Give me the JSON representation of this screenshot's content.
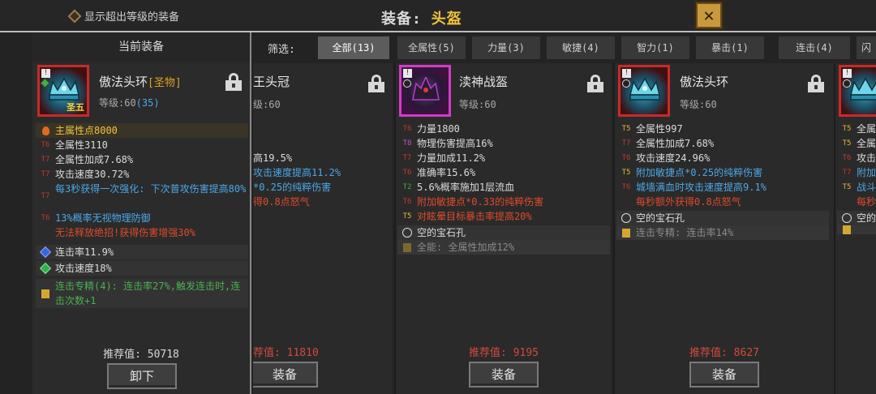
{
  "top": {
    "show_over_level": "显示超出等级的装备",
    "title_label": "装备:",
    "title_value": "头盔",
    "close_symbol": "✕"
  },
  "current": {
    "header": "当前装备",
    "name": "傲法头环",
    "quality": "[圣物]",
    "level_label": "等级:60",
    "level_bonus": "(35)",
    "icon_tag": "圣五",
    "badge": "!",
    "main_attr": "主属性点8000",
    "stats": [
      {
        "tier": "T6",
        "text": "全属性3110",
        "color": "white"
      },
      {
        "tier": "T7",
        "text": "全属性加成7.68%",
        "color": "white"
      },
      {
        "tier": "T7",
        "text": "攻击速度30.72%",
        "color": "white"
      },
      {
        "tier": "T7",
        "text": "每3秒获得一次强化: 下次普攻伤害提高80%",
        "color": "blue"
      },
      {
        "tier": "T6",
        "text": "13%概率无视物理防御",
        "color": "blue"
      }
    ],
    "legend_line": "无法释放绝招!获得伤害增强30%",
    "gem1": "连击率11.9%",
    "gem2": "攻击速度18%",
    "mastery": "连击专精(4): 连击率27%,触发连击时,连击次数+1",
    "rec_label": "推荐值:",
    "rec_value": "50718",
    "unequip": "卸下"
  },
  "filter": {
    "label": "筛选:",
    "tabs": [
      "全部(13)",
      "全属性(5)",
      "力量(3)",
      "敏捷(4)",
      "智力(1)",
      "暴击(1)",
      "连击(4)",
      "闪"
    ]
  },
  "items": [
    {
      "name": "王头冠",
      "level": "级:60",
      "stats": [
        {
          "tier": "",
          "text": "高19.5%",
          "color": "white"
        },
        {
          "tier": "",
          "text": "攻击速度提高11.2%",
          "color": "blue"
        },
        {
          "tier": "",
          "text": "*0.25的纯粹伤害",
          "color": "blue"
        },
        {
          "tier": "",
          "text": "得0.8点怒气",
          "color": "red"
        }
      ],
      "rec_label": "荐值:",
      "rec_value": "11810",
      "equip": "装备"
    },
    {
      "name": "渎神战盔",
      "level": "等级:60",
      "badge": "!",
      "stats": [
        {
          "tier": "T6",
          "text": "力量1800",
          "color": "white"
        },
        {
          "tier": "T8",
          "text": "物理伤害提高16%",
          "color": "white"
        },
        {
          "tier": "T7",
          "text": "力量加成11.2%",
          "color": "white"
        },
        {
          "tier": "T6",
          "text": "准确率15.6%",
          "color": "white"
        },
        {
          "tier": "T2",
          "text": "5.6%概率施加1层流血",
          "color": "white"
        },
        {
          "tier": "T6",
          "text": "附加敏捷点*0.33的纯粹伤害",
          "color": "red"
        },
        {
          "tier": "T5",
          "text": "对眩晕目标暴击率提高20%",
          "color": "red"
        }
      ],
      "socket": "空的宝石孔",
      "passive": "全能: 全属性加成12%",
      "rec_label": "推荐值:",
      "rec_value": "9195",
      "equip": "装备"
    },
    {
      "name": "傲法头环",
      "level": "等级:60",
      "badge": "!",
      "stats": [
        {
          "tier": "T5",
          "text": "全属性997",
          "color": "white"
        },
        {
          "tier": "T7",
          "text": "全属性加成7.68%",
          "color": "white"
        },
        {
          "tier": "T6",
          "text": "攻击速度24.96%",
          "color": "white"
        },
        {
          "tier": "T5",
          "text": "附加敏捷点*0.25的纯粹伤害",
          "color": "blue"
        },
        {
          "tier": "T6",
          "text": "城墙满血时攻击速度提高9.1%",
          "color": "blue"
        },
        {
          "tier": "",
          "text": "每秒额外获得0.8点怒气",
          "color": "red"
        }
      ],
      "socket": "空的宝石孔",
      "passive": "连击专精: 连击率14%",
      "rec_label": "推荐值:",
      "rec_value": "8627",
      "equip": "装备"
    },
    {
      "badge": "!",
      "stats": [
        {
          "tier": "T5",
          "text": "全属",
          "color": "white"
        },
        {
          "tier": "T5",
          "text": "全属",
          "color": "white"
        },
        {
          "tier": "T6",
          "text": "攻击",
          "color": "white"
        },
        {
          "tier": "T7",
          "text": "附加",
          "color": "blue"
        },
        {
          "tier": "T5",
          "text": "战斗",
          "color": "blue"
        },
        {
          "tier": "",
          "text": "每秒",
          "color": "red"
        }
      ],
      "socket": "空的",
      "passive": ""
    }
  ]
}
